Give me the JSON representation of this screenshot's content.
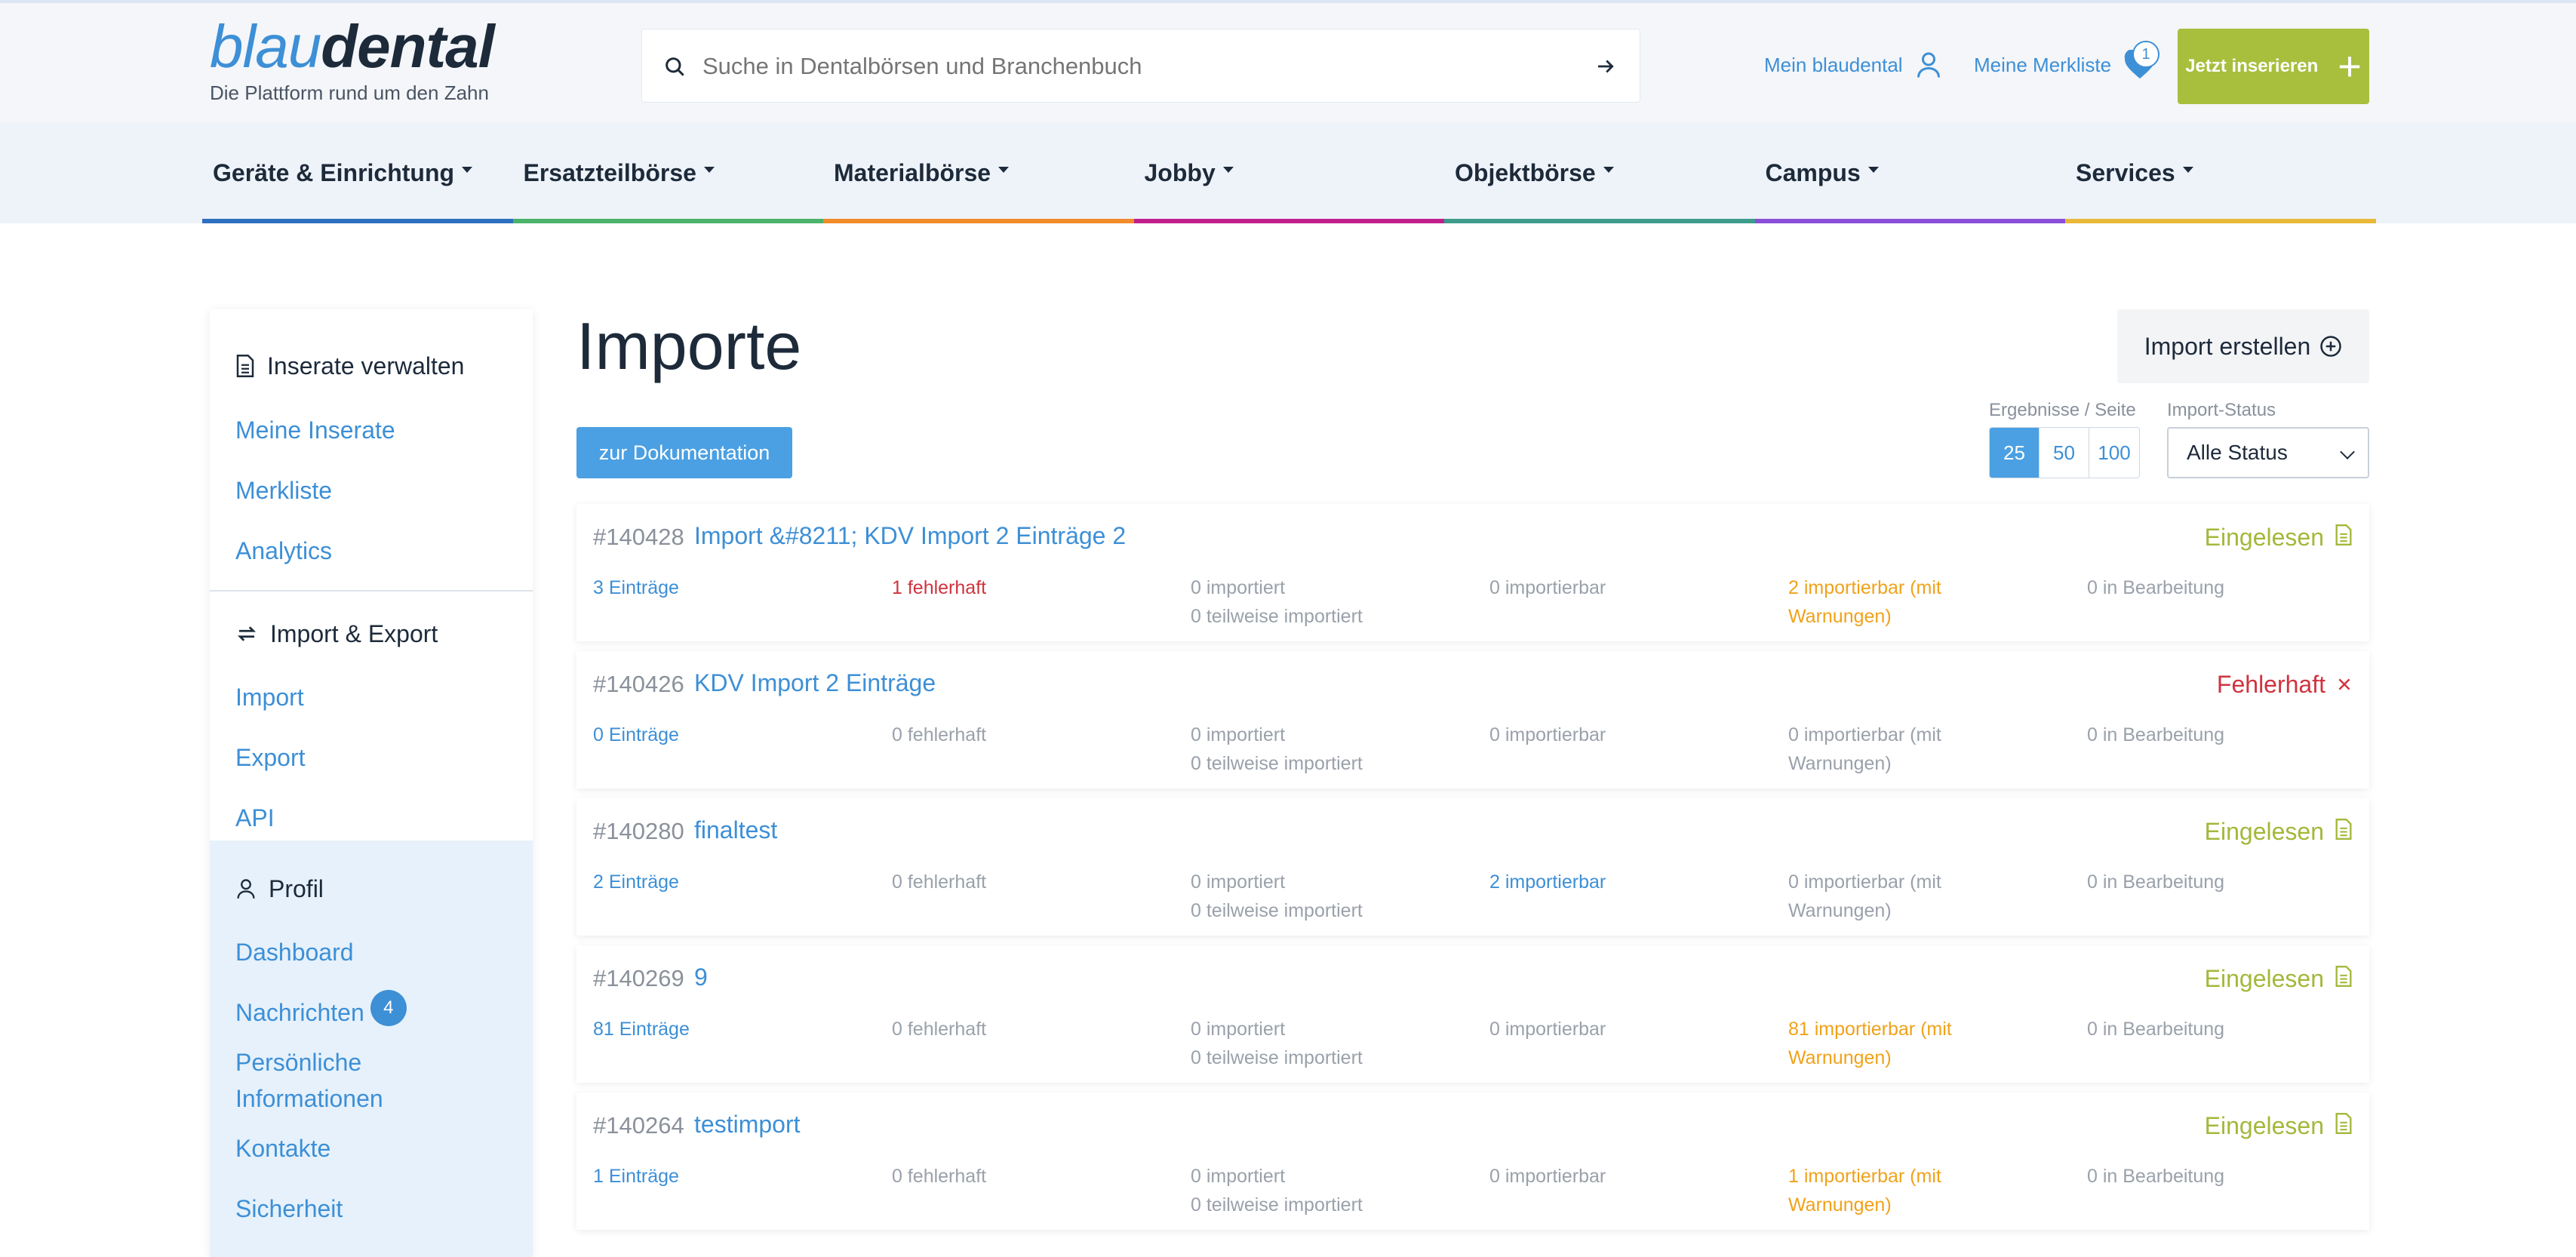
{
  "header": {
    "logo_part1": "blau",
    "logo_part2": "dental",
    "tagline": "Die Plattform rund um den Zahn",
    "search_placeholder": "Suche in Dentalbörsen und Branchenbuch",
    "my_account": "Mein blaudental",
    "wishlist": "Meine Merkliste",
    "wishlist_count": "1",
    "cta": "Jetzt inserieren"
  },
  "nav": [
    {
      "label": "Geräte & Einrichtung",
      "color": "#2f6fbf"
    },
    {
      "label": "Ersatzteilbörse",
      "color": "#4bb36b"
    },
    {
      "label": "Materialbörse",
      "color": "#f08c2a"
    },
    {
      "label": "Jobby",
      "color": "#c21f8e"
    },
    {
      "label": "Objektbörse",
      "color": "#3e9c8c"
    },
    {
      "label": "Campus",
      "color": "#8a4fd8"
    },
    {
      "label": "Services",
      "color": "#e8b83a"
    }
  ],
  "sidebar": {
    "manage_title": "Inserate verwalten",
    "manage_items": [
      "Meine Inserate",
      "Merkliste",
      "Analytics"
    ],
    "io_title": "Import & Export",
    "io_items": [
      "Import",
      "Export",
      "API"
    ],
    "profile_title": "Profil",
    "profile_items": [
      "Dashboard",
      "Nachrichten",
      "Persönliche Informationen",
      "Kontakte",
      "Sicherheit"
    ],
    "messages_count": "4"
  },
  "main": {
    "title": "Importe",
    "create_button": "Import erstellen",
    "doc_button": "zur Dokumentation",
    "per_page_label": "Ergebnisse / Seite",
    "per_page_options": [
      "25",
      "50",
      "100"
    ],
    "per_page_selected": "25",
    "status_label": "Import-Status",
    "status_value": "Alle Status"
  },
  "imports": [
    {
      "id": "#140428",
      "title": "Import &#8211; KDV Import 2 Einträge 2",
      "status": "Eingelesen",
      "status_kind": "ok",
      "entries": "3 Einträge",
      "faulty": "1 fehlerhaft",
      "imported": "0 importiert",
      "partial": "0 teilweise importiert",
      "importable": "0 importierbar",
      "warnings": "2 importierbar (mit Warnungen)",
      "processing": "0 in Bearbeitung",
      "faulty_color": "red",
      "importable_color": "grey",
      "warnings_color": "orange"
    },
    {
      "id": "#140426",
      "title": "KDV Import 2 Einträge",
      "status": "Fehlerhaft",
      "status_kind": "error",
      "entries": "0 Einträge",
      "faulty": "0 fehlerhaft",
      "imported": "0 importiert",
      "partial": "0 teilweise importiert",
      "importable": "0 importierbar",
      "warnings": "0 importierbar (mit Warnungen)",
      "processing": "0 in Bearbeitung",
      "faulty_color": "grey",
      "importable_color": "grey",
      "warnings_color": "grey"
    },
    {
      "id": "#140280",
      "title": "finaltest",
      "status": "Eingelesen",
      "status_kind": "ok",
      "entries": "2 Einträge",
      "faulty": "0 fehlerhaft",
      "imported": "0 importiert",
      "partial": "0 teilweise importiert",
      "importable": "2 importierbar",
      "warnings": "0 importierbar (mit Warnungen)",
      "processing": "0 in Bearbeitung",
      "faulty_color": "grey",
      "importable_color": "blue",
      "warnings_color": "grey"
    },
    {
      "id": "#140269",
      "title": "9",
      "status": "Eingelesen",
      "status_kind": "ok",
      "entries": "81 Einträge",
      "faulty": "0 fehlerhaft",
      "imported": "0 importiert",
      "partial": "0 teilweise importiert",
      "importable": "0 importierbar",
      "warnings": "81 importierbar (mit Warnungen)",
      "processing": "0 in Bearbeitung",
      "faulty_color": "grey",
      "importable_color": "grey",
      "warnings_color": "orange"
    },
    {
      "id": "#140264",
      "title": "testimport",
      "status": "Eingelesen",
      "status_kind": "ok",
      "entries": "1 Einträge",
      "faulty": "0 fehlerhaft",
      "imported": "0 importiert",
      "partial": "0 teilweise importiert",
      "importable": "0 importierbar",
      "warnings": "1 importierbar (mit Warnungen)",
      "processing": "0 in Bearbeitung",
      "faulty_color": "grey",
      "importable_color": "grey",
      "warnings_color": "orange"
    }
  ]
}
